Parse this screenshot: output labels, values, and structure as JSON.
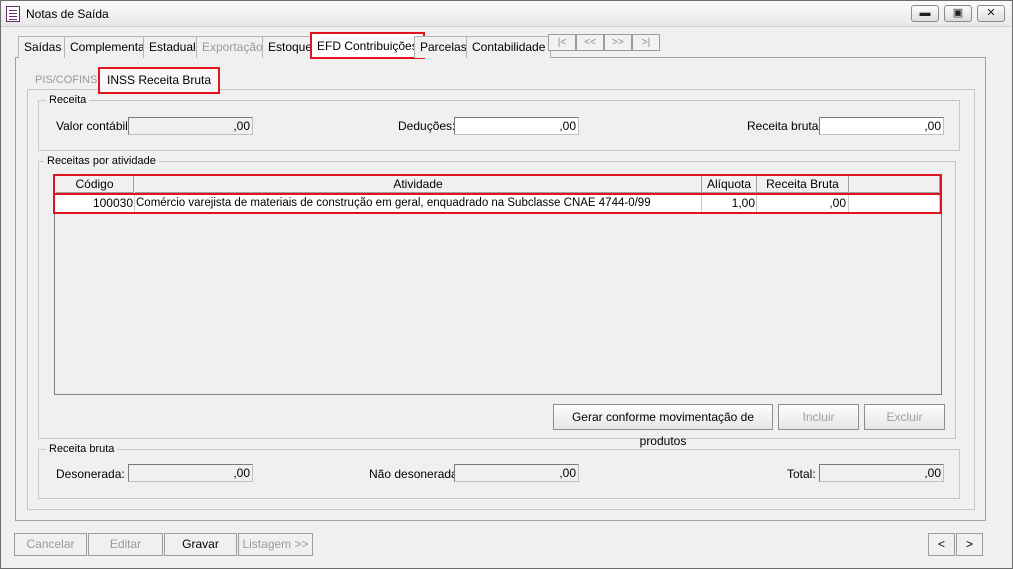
{
  "window": {
    "title": "Notas de Saída",
    "minimize": "▬",
    "restore": "▣",
    "close": "✕"
  },
  "tabs": [
    {
      "label": "Saídas"
    },
    {
      "label": "Complementar"
    },
    {
      "label": "Estadual"
    },
    {
      "label": "Exportação"
    },
    {
      "label": "Estoque"
    },
    {
      "label": "EFD Contribuições"
    },
    {
      "label": "Parcelas"
    },
    {
      "label": "Contabilidade"
    }
  ],
  "record_nav": {
    "first": "|<",
    "prev": "<<",
    "next": ">>",
    "last": ">|"
  },
  "subtabs": {
    "pis_cofins": "PIS/COFINS",
    "inss": "INSS Receita Bruta"
  },
  "receita": {
    "title": "Receita",
    "valor_contabil_label": "Valor contábil:",
    "valor_contabil": ",00",
    "deducoes_label": "Deduções:",
    "deducoes": ",00",
    "receita_bruta_label": "Receita bruta:",
    "receita_bruta": ",00"
  },
  "atividades": {
    "title": "Receitas por atividade",
    "columns": [
      "Código",
      "Atividade",
      "Alíquota",
      "Receita Bruta"
    ],
    "rows": [
      {
        "codigo": "100030",
        "atividade": "Comércio varejista de materiais de construção em geral, enquadrado na Subclasse CNAE 4744-0/99",
        "aliquota": "1,00",
        "receita_bruta": ",00"
      }
    ],
    "gerar_button": "Gerar conforme movimentação de produtos",
    "incluir_button": "Incluir",
    "excluir_button": "Excluir"
  },
  "receita_bruta": {
    "title": "Receita bruta",
    "desonerada_label": "Desonerada:",
    "desonerada": ",00",
    "nao_desonerada_label": "Não desonerada:",
    "nao_desonerada": ",00",
    "total_label": "Total:",
    "total": ",00"
  },
  "footer": {
    "cancelar": "Cancelar",
    "editar": "Editar",
    "gravar": "Gravar",
    "listagem": "Listagem >>",
    "prev": "<",
    "next": ">"
  },
  "colors": {
    "highlight": "#e0141e",
    "window_bg": "#f0f0f0"
  }
}
